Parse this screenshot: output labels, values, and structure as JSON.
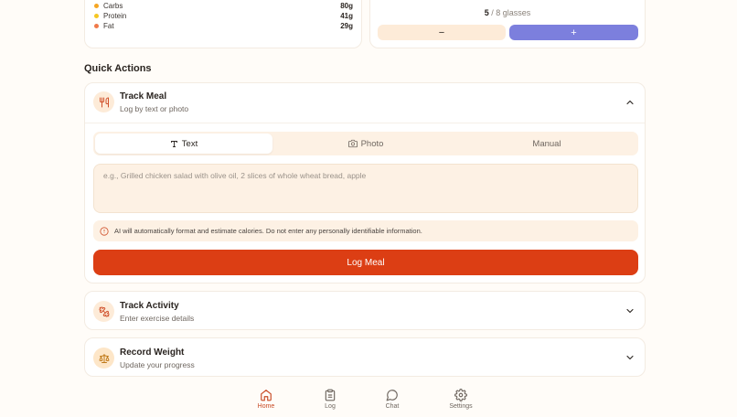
{
  "macros": [
    {
      "name": "Carbs",
      "value": "80g",
      "color": "#f5a623"
    },
    {
      "name": "Protein",
      "value": "41g",
      "color": "#f5c623"
    },
    {
      "name": "Fat",
      "value": "29g",
      "color": "#f07a4a"
    }
  ],
  "water": {
    "count": "5",
    "total_text": "/ 8 glasses",
    "minus_label": "−",
    "plus_label": "+"
  },
  "quick_actions": {
    "title": "Quick Actions",
    "track_meal": {
      "title": "Track Meal",
      "subtitle": "Log by text or photo",
      "tabs": [
        "Text",
        "Photo",
        "Manual"
      ],
      "active_tab": "Text",
      "input_placeholder": "e.g., Grilled chicken salad with olive oil, 2 slices of whole wheat bread, apple",
      "notice": "AI will automatically format and estimate calories. Do not enter any personally identifiable information.",
      "submit_label": "Log Meal"
    },
    "track_activity": {
      "title": "Track Activity",
      "subtitle": "Enter exercise details"
    },
    "record_weight": {
      "title": "Record Weight",
      "subtitle": "Update your progress"
    }
  },
  "nav": {
    "items": [
      {
        "label": "Home",
        "icon": "home-icon",
        "active": true
      },
      {
        "label": "Log",
        "icon": "clipboard-icon",
        "active": false
      },
      {
        "label": "Chat",
        "icon": "chat-bubble-icon",
        "active": false
      },
      {
        "label": "Settings",
        "icon": "gear-icon",
        "active": false
      }
    ]
  },
  "colors": {
    "accent": "#dc3e14",
    "water_plus": "#7c7fdd",
    "soft_bg": "#fdf1e4",
    "nav_active": "#c84a24"
  }
}
